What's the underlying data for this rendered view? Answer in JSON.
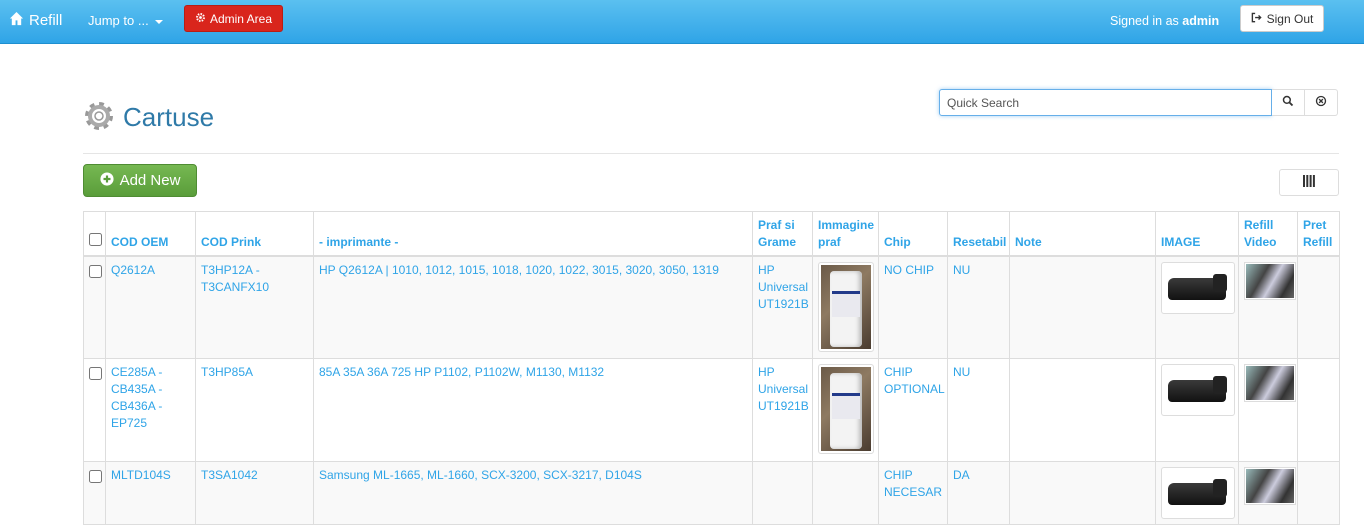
{
  "nav": {
    "brand": "Refill",
    "jump": "Jump to ...",
    "admin": "Admin Area",
    "signed_prefix": "Signed in as",
    "signed_user": "admin",
    "signout": "Sign Out"
  },
  "page": {
    "title": "Cartuse",
    "search_placeholder": "Quick Search",
    "add_new": "Add New"
  },
  "table": {
    "headers": {
      "cod_oem": "COD OEM",
      "cod_prink": "COD Prink",
      "imprimante": "- imprimante -",
      "praf_1": "Praf si",
      "praf_2": "Grame",
      "img_praf_1": "Immagine",
      "img_praf_2": "praf",
      "chip": "Chip",
      "resetabil": "Resetabil",
      "note": "Note",
      "image": "IMAGE",
      "video_1": "Refill",
      "video_2": "Video",
      "pret_1": "Pret",
      "pret_2": "Refill"
    },
    "rows": [
      {
        "oem": [
          "Q2612A"
        ],
        "prink": [
          "T3HP12A -",
          "T3CANFX10"
        ],
        "imprimante": "HP Q2612A | 1010, 1012, 1015, 1018, 1020, 1022, 3015, 3020, 3050, 1319",
        "praf": [
          "HP",
          "Universal",
          "UT1921B"
        ],
        "chip": [
          "NO CHIP"
        ],
        "resetabil": "NU",
        "note": "",
        "pret": ""
      },
      {
        "oem": [
          "CE285A -",
          "CB435A -",
          "CB436A -",
          "EP725"
        ],
        "prink": [
          "T3HP85A"
        ],
        "imprimante": "85A 35A 36A 725 HP P1102, P1102W, M1130, M1132",
        "praf": [
          "HP",
          "Universal",
          "UT1921B"
        ],
        "chip": [
          "CHIP",
          "OPTIONAL"
        ],
        "resetabil": "NU",
        "note": "",
        "pret": ""
      },
      {
        "oem": [
          "MLTD104S"
        ],
        "prink": [
          "T3SA1042"
        ],
        "imprimante": "Samsung ML-1665, ML-1660, SCX-3200, SCX-3217, D104S",
        "praf": [],
        "chip": [
          "CHIP",
          "NECESAR"
        ],
        "resetabil": "DA",
        "note": "",
        "pret": ""
      }
    ]
  }
}
